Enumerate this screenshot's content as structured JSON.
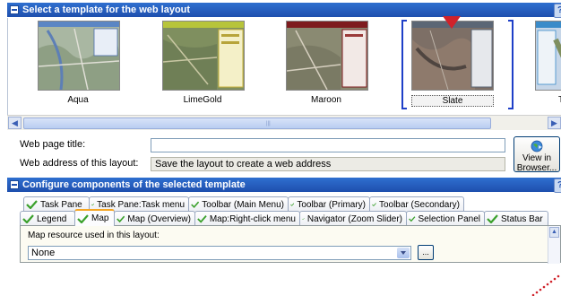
{
  "templates_section": {
    "title": "Select a template for the web layout",
    "templates": [
      {
        "name": "Aqua",
        "selected": false
      },
      {
        "name": "LimeGold",
        "selected": false
      },
      {
        "name": "Maroon",
        "selected": false
      },
      {
        "name": "Slate",
        "selected": true
      },
      {
        "name": "Tu",
        "selected": false
      }
    ]
  },
  "form": {
    "web_title_label": "Web page title:",
    "web_title_value": "",
    "web_address_label": "Web address of this layout:",
    "web_address_value": "Save the layout to create a web address",
    "view_button_line1": "View in",
    "view_button_line2": "Browser..."
  },
  "components_section": {
    "title": "Configure components of the selected template",
    "tabs_row1": [
      "Task Pane",
      "Task Pane:Task menu",
      "Toolbar (Main Menu)",
      "Toolbar (Primary)",
      "Toolbar (Secondary)"
    ],
    "tabs_row2": [
      "Legend",
      "Map",
      "Map (Overview)",
      "Map:Right-click menu",
      "Navigator (Zoom Slider)",
      "Selection Panel",
      "Status Bar"
    ],
    "active_tab": "Map",
    "map_resource_label": "Map resource used in this layout:",
    "map_resource_value": "None",
    "browse_button_label": "..."
  },
  "icons": {
    "collapse": "collapse-icon",
    "help": "help-icon",
    "check": "check-icon",
    "globe": "globe-icon",
    "dropdown": "chevron-down-icon"
  },
  "colors": {
    "header_blue": "#1e4fae",
    "selection_blue": "#1e3fc8",
    "marker_red": "#d0222a",
    "active_tab_orange": "#f5a623"
  }
}
